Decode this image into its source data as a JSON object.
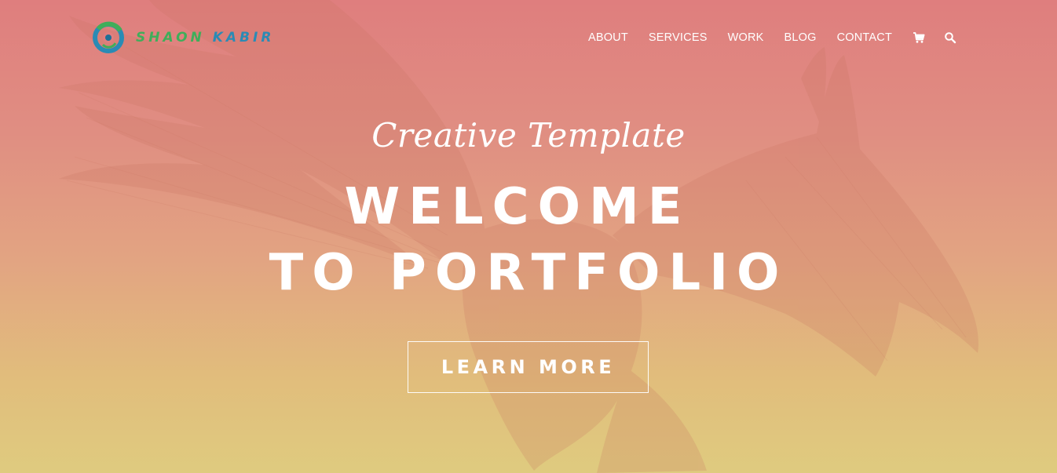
{
  "logo": {
    "word1": "SHAON",
    "word2": "KABIR",
    "colors": {
      "green": "#3fae5a",
      "blue": "#2a8bb5"
    }
  },
  "nav": {
    "items": [
      {
        "label": "ABOUT"
      },
      {
        "label": "SERVICES"
      },
      {
        "label": "WORK"
      },
      {
        "label": "BLOG"
      },
      {
        "label": "CONTACT"
      }
    ],
    "icons": [
      "cart-icon",
      "search-icon"
    ]
  },
  "hero": {
    "tagline": "Creative Template",
    "headline_line1": "WELCOME",
    "headline_line2": "TO PORTFOLIO",
    "cta_label": "LEARN MORE",
    "background_image": "eagle-with-spread-wings",
    "gradient_top": "#df7e7e",
    "gradient_bottom": "#dfcb7f"
  }
}
